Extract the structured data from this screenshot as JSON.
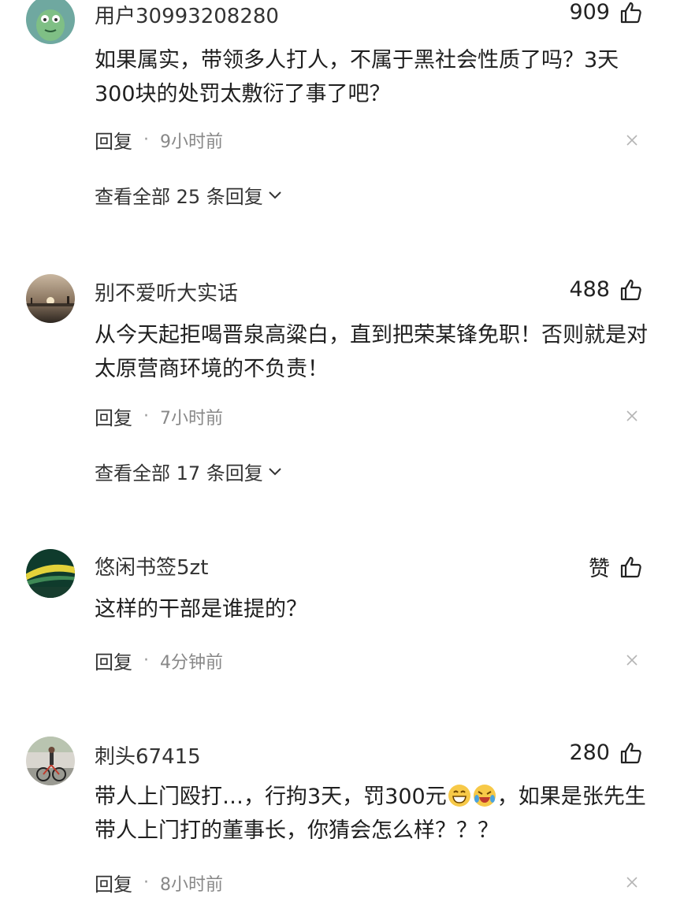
{
  "comments": [
    {
      "username": "用户30993208280",
      "likes": "909",
      "text": "如果属实，带领多人打人，不属于黑社会性质了吗？3天300块的处罚太敷衍了事了吧？",
      "reply_label": "回复",
      "time": "9小时前",
      "view_replies": "查看全部 25 条回复"
    },
    {
      "username": "别不爱听大实话",
      "likes": "488",
      "text": "从今天起拒喝晋泉高粱白，直到把荣某锋免职！否则就是对太原营商环境的不负责！",
      "reply_label": "回复",
      "time": "7小时前",
      "view_replies": "查看全部 17 条回复"
    },
    {
      "username": "悠闲书签5zt",
      "likes": "赞",
      "text": "这样的干部是谁提的？",
      "reply_label": "回复",
      "time": "4分钟前"
    },
    {
      "username": "刺头67415",
      "likes": "280",
      "text_before_emoji": "带人上门殴打…，行拘3天，罚300元",
      "text_after_emoji": "，如果是张先生带人上门打的董事长，你猜会怎么样？？？",
      "reply_label": "回复",
      "time": "8小时前"
    }
  ],
  "icons": {
    "like": "thumbs-up-icon",
    "close": "close-icon",
    "expand": "chevron-down-icon",
    "emoji": [
      "grin-emoji",
      "laughing-crying-emoji"
    ]
  }
}
